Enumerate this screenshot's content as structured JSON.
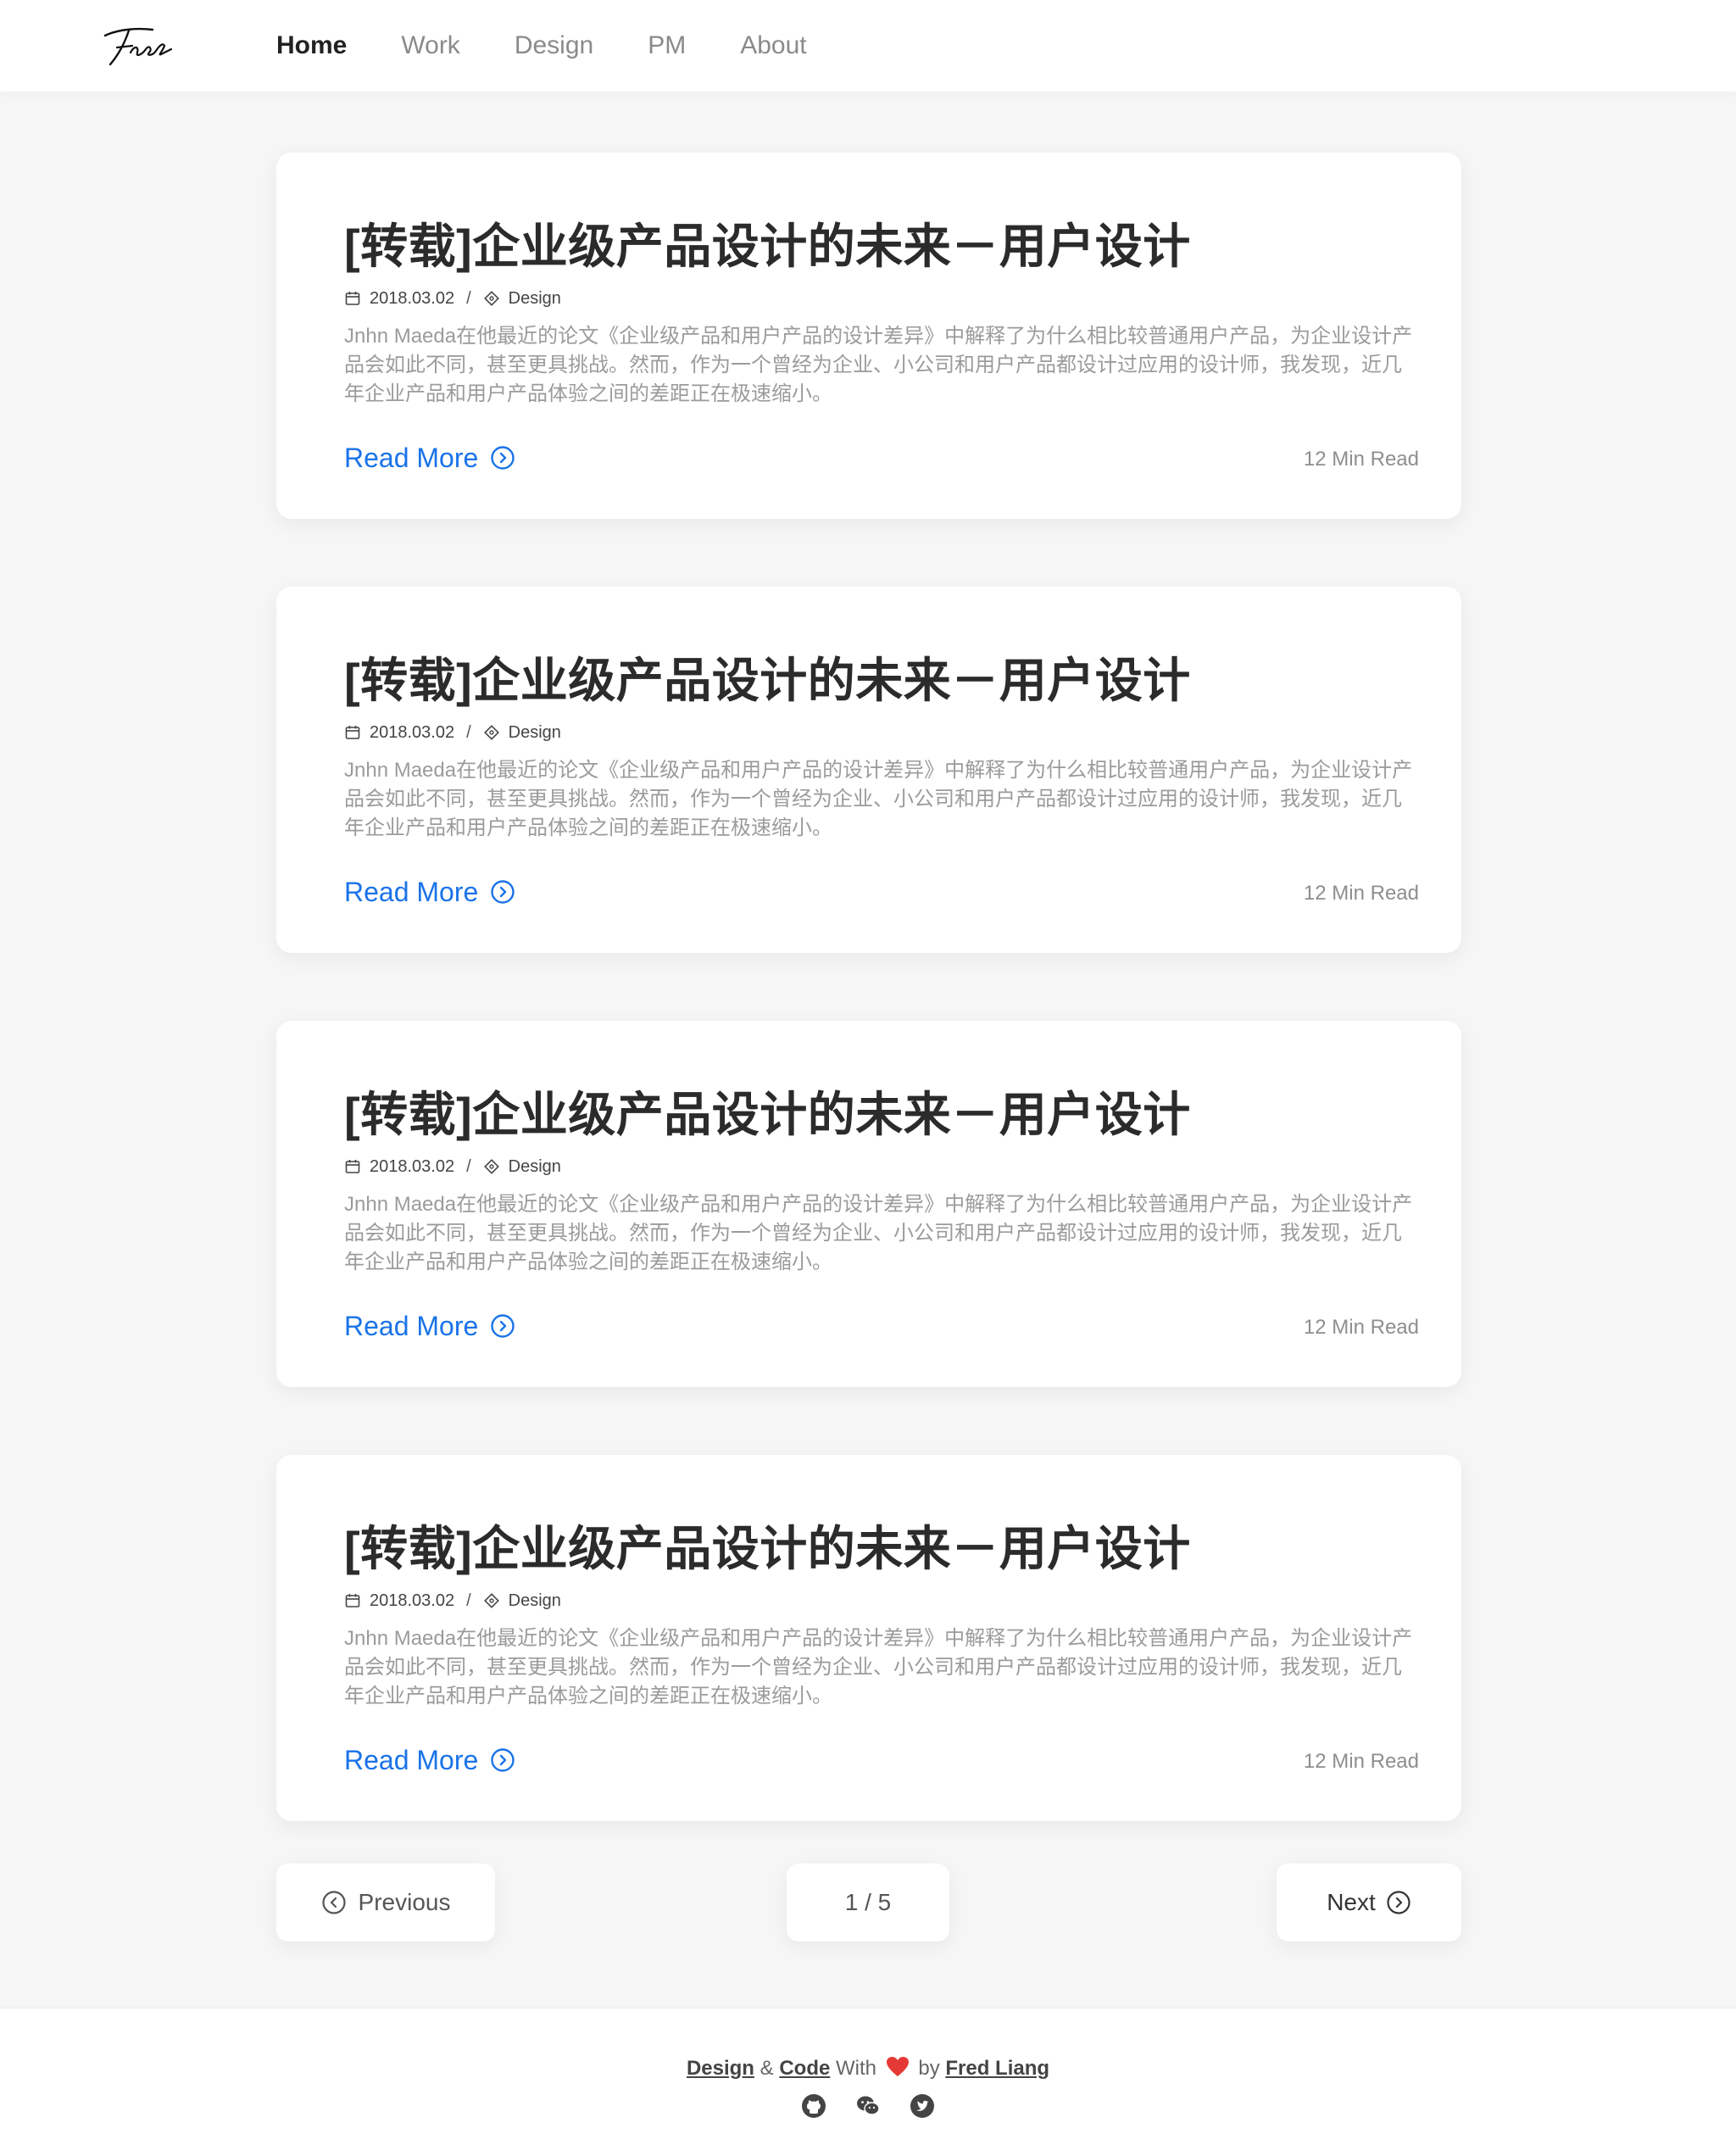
{
  "nav": {
    "items": [
      {
        "label": "Home",
        "active": true
      },
      {
        "label": "Work",
        "active": false
      },
      {
        "label": "Design",
        "active": false
      },
      {
        "label": "PM",
        "active": false
      },
      {
        "label": "About",
        "active": false
      }
    ]
  },
  "posts": [
    {
      "title": "[转载]企业级产品设计的未来－用户设计",
      "date": "2018.03.02",
      "category": "Design",
      "excerpt": "Jnhn Maeda在他最近的论文《企业级产品和用户产品的设计差异》中解释了为什么相比较普通用户产品，为企业设计产品会如此不同，甚至更具挑战。然而，作为一个曾经为企业、小公司和用户产品都设计过应用的设计师，我发现，近几年企业产品和用户产品体验之间的差距正在极速缩小。",
      "read_more": "Read More",
      "read_time": "12 Min Read"
    },
    {
      "title": "[转载]企业级产品设计的未来－用户设计",
      "date": "2018.03.02",
      "category": "Design",
      "excerpt": "Jnhn Maeda在他最近的论文《企业级产品和用户产品的设计差异》中解释了为什么相比较普通用户产品，为企业设计产品会如此不同，甚至更具挑战。然而，作为一个曾经为企业、小公司和用户产品都设计过应用的设计师，我发现，近几年企业产品和用户产品体验之间的差距正在极速缩小。",
      "read_more": "Read More",
      "read_time": "12 Min Read"
    },
    {
      "title": "[转载]企业级产品设计的未来－用户设计",
      "date": "2018.03.02",
      "category": "Design",
      "excerpt": "Jnhn Maeda在他最近的论文《企业级产品和用户产品的设计差异》中解释了为什么相比较普通用户产品，为企业设计产品会如此不同，甚至更具挑战。然而，作为一个曾经为企业、小公司和用户产品都设计过应用的设计师，我发现，近几年企业产品和用户产品体验之间的差距正在极速缩小。",
      "read_more": "Read More",
      "read_time": "12 Min Read"
    },
    {
      "title": "[转载]企业级产品设计的未来－用户设计",
      "date": "2018.03.02",
      "category": "Design",
      "excerpt": "Jnhn Maeda在他最近的论文《企业级产品和用户产品的设计差异》中解释了为什么相比较普通用户产品，为企业设计产品会如此不同，甚至更具挑战。然而，作为一个曾经为企业、小公司和用户产品都设计过应用的设计师，我发现，近几年企业产品和用户产品体验之间的差距正在极速缩小。",
      "read_more": "Read More",
      "read_time": "12 Min Read"
    }
  ],
  "pagination": {
    "previous_label": "Previous",
    "page_indicator": "1 / 5",
    "next_label": "Next"
  },
  "footer": {
    "design_link": "Design",
    "amp": "&",
    "code_link": "Code",
    "with_text": "With",
    "by_text": "by",
    "author_link": "Fred Liang",
    "social_icons": [
      "github-icon",
      "wechat-icon",
      "twitter-icon"
    ]
  },
  "colors": {
    "accent": "#1a73e8",
    "heart": "#e53935",
    "background": "#f6f6f6"
  }
}
